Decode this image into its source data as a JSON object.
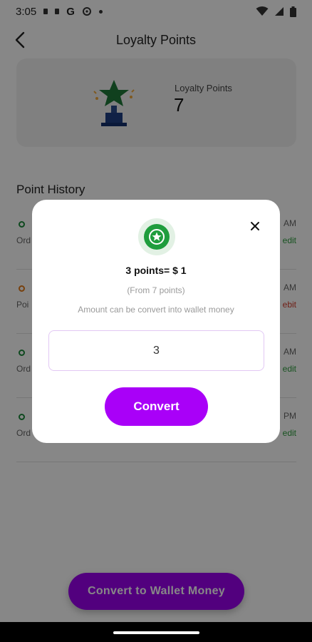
{
  "status_bar": {
    "time": "3:05",
    "google_glyph": "G",
    "icons": [
      "notification-icon",
      "notification-icon",
      "google-icon",
      "settings-icon",
      "dot-icon",
      "wifi-icon",
      "signal-icon",
      "battery-icon"
    ]
  },
  "app_bar": {
    "title": "Loyalty Points",
    "back_icon": "arrow-left-icon"
  },
  "points_card": {
    "label": "Loyalty Points",
    "value": "7",
    "icon": "trophy-icon"
  },
  "history": {
    "title": "Point History",
    "rows": [
      {
        "sub": "Ord",
        "time": "AM",
        "type": "edit",
        "status": "credit"
      },
      {
        "sub": "Poi",
        "time": "AM",
        "type": "ebit",
        "status": "debit"
      },
      {
        "sub": "Ord",
        "time": "AM",
        "type": "edit",
        "status": "credit"
      },
      {
        "sub": "Ord",
        "time": "PM",
        "type": "edit",
        "status": "credit"
      }
    ]
  },
  "footer": {
    "convert_label": "Convert to Wallet Money"
  },
  "dialog": {
    "rate_text": "3 points= $ 1",
    "from_text": "(From 7 points)",
    "hint_text": "Amount can be convert into wallet money",
    "input_value": "3",
    "convert_label": "Convert",
    "close_icon": "close-icon",
    "star_icon": "star-icon"
  },
  "colors": {
    "accent": "#a900f8",
    "credit": "#2e9e3e",
    "debit": "#d43b2a",
    "star_green": "#1f9d3d"
  }
}
